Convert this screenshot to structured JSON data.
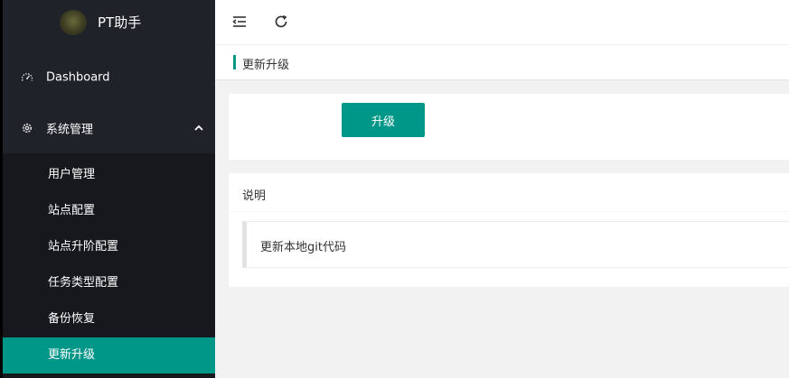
{
  "app": {
    "title": "PT助手"
  },
  "sidebar": {
    "dashboard_label": "Dashboard",
    "system_label": "系统管理",
    "submenu": [
      {
        "label": "用户管理"
      },
      {
        "label": "站点配置"
      },
      {
        "label": "站点升阶配置"
      },
      {
        "label": "任务类型配置"
      },
      {
        "label": "备份恢复"
      },
      {
        "label": "更新升级",
        "active": true
      }
    ]
  },
  "toolbar": {
    "menu_toggle_icon": "menu-fold-icon",
    "refresh_icon": "refresh-icon"
  },
  "breadcrumb": {
    "label": "更新升级"
  },
  "upgrade": {
    "button_label": "升级"
  },
  "notes": {
    "title": "说明",
    "text": "更新本地git代码"
  },
  "colors": {
    "accent": "#009688",
    "sidebar": "#20222a",
    "submenu": "#17181d"
  }
}
